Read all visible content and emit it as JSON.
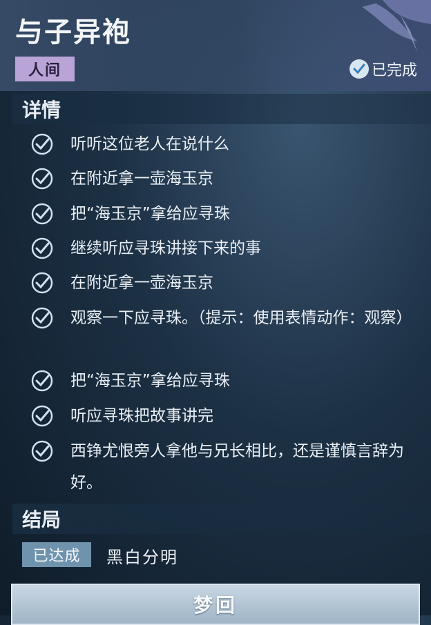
{
  "quest": {
    "title": "与子异袍",
    "realm_tag": "人间",
    "status": "已完成"
  },
  "details": {
    "heading": "详情",
    "tasks": [
      "听听这位老人在说什么",
      "在附近拿一壶海玉京",
      "把“海玉京”拿给应寻珠",
      "继续听应寻珠讲接下来的事",
      "在附近拿一壶海玉京",
      "观察一下应寻珠。（提示：使用表情动作：观察）",
      "把“海玉京”拿给应寻珠",
      "听应寻珠把故事讲完",
      "西铮尤恨旁人拿他与兄长相比，还是谨慎言辞为好。"
    ]
  },
  "ending": {
    "heading": "结局",
    "achieved_tag": "已达成",
    "name": "黑白分明"
  },
  "actions": {
    "dream_button": "梦回"
  },
  "colors": {
    "realm_tag_bg": "#b9a4d8",
    "achieved_tag_bg": "#6f93ad",
    "check_color": "#cfe3f2"
  }
}
